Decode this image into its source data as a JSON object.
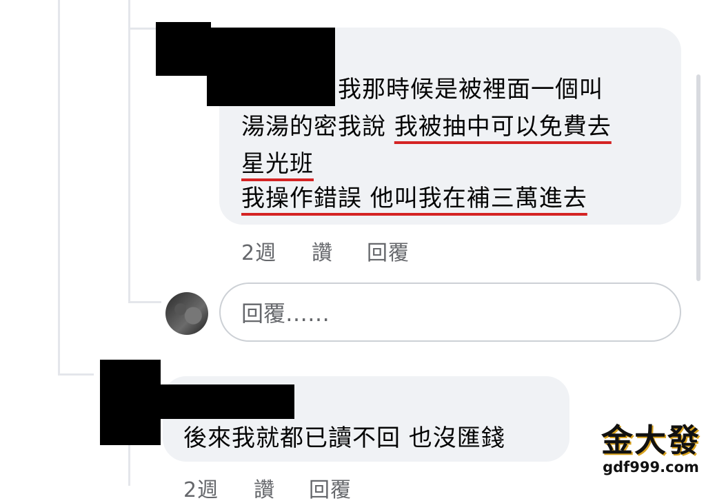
{
  "comments": [
    {
      "lines": [
        {
          "parts": [
            {
              "text": "我那時候是被裡面一個叫",
              "underline": false
            }
          ]
        },
        {
          "parts": [
            {
              "text": "湯湯的密我說 ",
              "underline": false
            },
            {
              "text": "我被抽中可以免費去",
              "underline": true
            }
          ]
        },
        {
          "parts": [
            {
              "text": "星光班",
              "underline": true
            }
          ]
        },
        {
          "parts": [
            {
              "text": "我操作錯誤 他叫我在補三萬進去",
              "underline": true
            }
          ]
        }
      ],
      "meta": {
        "time": "2週",
        "like": "讚",
        "reply": "回覆"
      }
    },
    {
      "lines": [
        {
          "parts": [
            {
              "text": "後來我就都已讀不回 也沒匯錢",
              "underline": false
            }
          ]
        }
      ],
      "meta": {
        "time": "2週",
        "like": "讚",
        "reply": "回覆"
      }
    }
  ],
  "reply_input": {
    "placeholder": "回覆……"
  },
  "watermark": {
    "logo": "金大發",
    "url": "gdf999.com"
  },
  "colors": {
    "bubble": "#f0f2f5",
    "underline": "#d42323",
    "meta_text": "#65676b"
  }
}
